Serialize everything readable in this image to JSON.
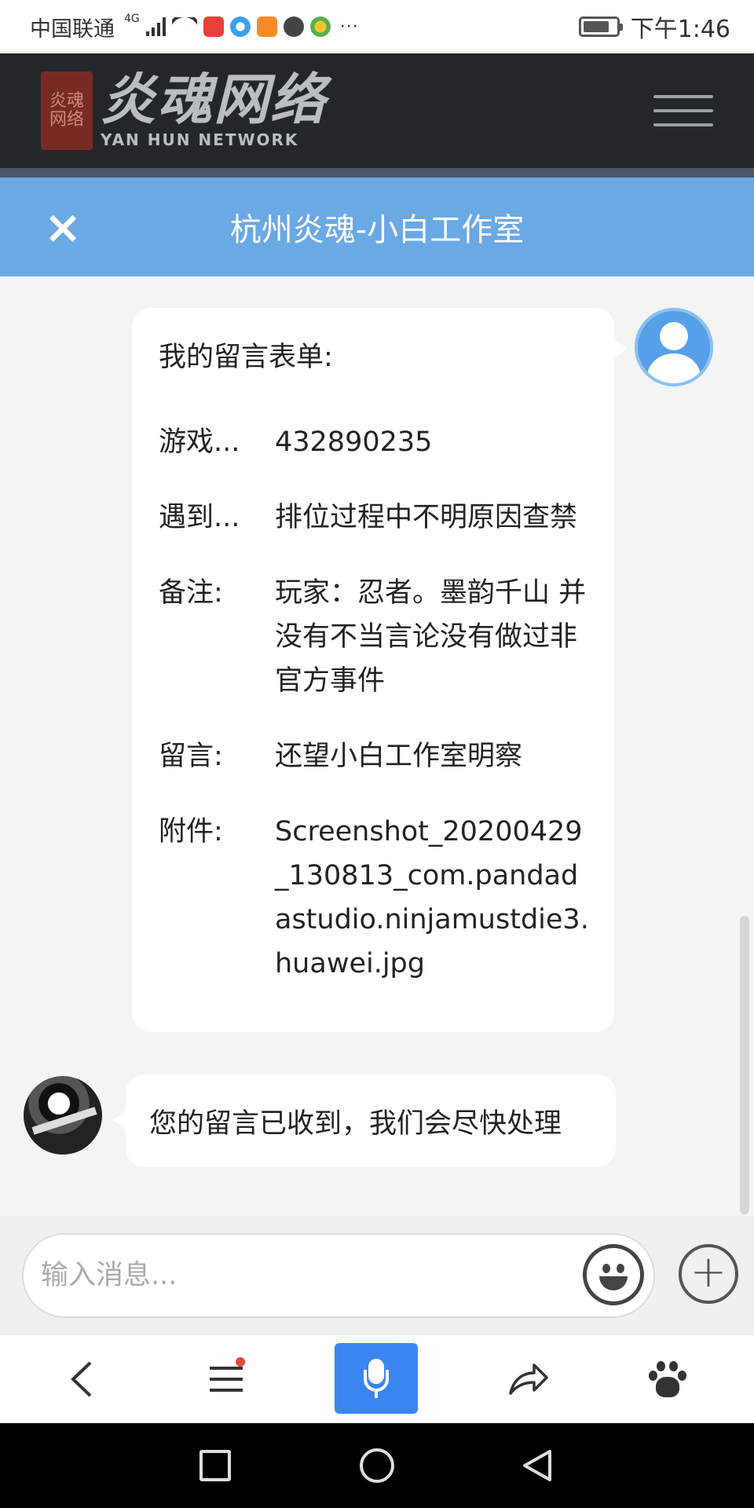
{
  "status_bar": {
    "carrier": "中国联通",
    "network": "4G",
    "more": "···",
    "time": "下午1:46",
    "battery_level": 0.8
  },
  "site_header": {
    "logo_seal": "炎魂网络",
    "logo_text_cn": "炎魂网络",
    "logo_text_en": "YAN HUN NETWORK",
    "menu_icon": "hamburger-icon"
  },
  "chat": {
    "title": "杭州炎魂-小白工作室",
    "close_icon": "close-icon",
    "form_message": {
      "title": "我的留言表单:",
      "fields": [
        {
          "label": "游戏...",
          "value": "432890235"
        },
        {
          "label": "遇到...",
          "value": "排位过程中不明原因查禁"
        },
        {
          "label": "备注:",
          "value": "玩家：忍者。墨韵千山 并没有不当言论没有做过非官方事件"
        },
        {
          "label": "留言:",
          "value": "还望小白工作室明察"
        },
        {
          "label": "附件:",
          "value": "Screenshot_20200429_130813_com.pandadastudio.ninjamustdie3.huawei.jpg"
        }
      ]
    },
    "reply_message": "您的留言已收到，我们会尽快处理"
  },
  "input": {
    "placeholder": "输入消息...",
    "emoji_icon": "emoji-icon",
    "add_icon": "plus-icon"
  },
  "browser_toolbar": {
    "items": [
      "back-icon",
      "menu-icon",
      "microphone-icon",
      "share-icon",
      "baidu-icon"
    ],
    "accent_color": "#3a86f0"
  },
  "nav_bar": {
    "items": [
      "recent-apps-icon",
      "home-icon",
      "back-icon"
    ]
  },
  "colors": {
    "header_bg": "#23272c",
    "chatbar_bg": "#6aa8e6",
    "chat_bg": "#f4f4f4"
  }
}
